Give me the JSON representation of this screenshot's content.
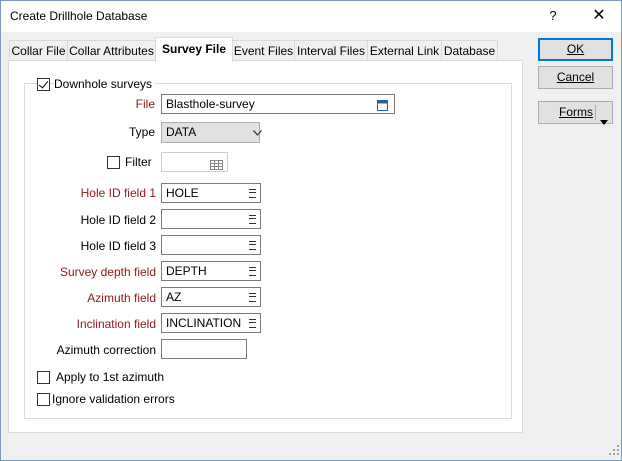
{
  "window": {
    "title": "Create Drillhole Database",
    "help_label": "?",
    "close_label": "✕"
  },
  "tabs": [
    {
      "label": "Collar File"
    },
    {
      "label": "Collar Attributes"
    },
    {
      "label": "Survey File"
    },
    {
      "label": "Event Files"
    },
    {
      "label": "Interval Files"
    },
    {
      "label": "External Link"
    },
    {
      "label": "Database"
    }
  ],
  "buttons": {
    "ok": "OK",
    "cancel": "Cancel",
    "forms": "Forms"
  },
  "form": {
    "downhole_label": "Downhole surveys",
    "downhole_checked": true,
    "file_label": "File",
    "file_value": "Blasthole-survey",
    "type_label": "Type",
    "type_value": "DATA",
    "filter_label": "Filter",
    "filter_value": "",
    "hole1_label": "Hole ID field 1",
    "hole1_value": "HOLE",
    "hole2_label": "Hole ID field 2",
    "hole2_value": "",
    "hole3_label": "Hole ID field 3",
    "hole3_value": "",
    "depth_label": "Survey depth field",
    "depth_value": "DEPTH",
    "azimuth_label": "Azimuth field",
    "azimuth_value": "AZ",
    "incl_label": "Inclination field",
    "incl_value": "INCLINATION",
    "azcorr_label": "Azimuth correction",
    "azcorr_value": "",
    "apply_label": "Apply to 1st azimuth",
    "ignore_label": "Ignore validation errors"
  },
  "colors": {
    "required_label": "#8b1a1a",
    "accent": "#0078d7"
  }
}
